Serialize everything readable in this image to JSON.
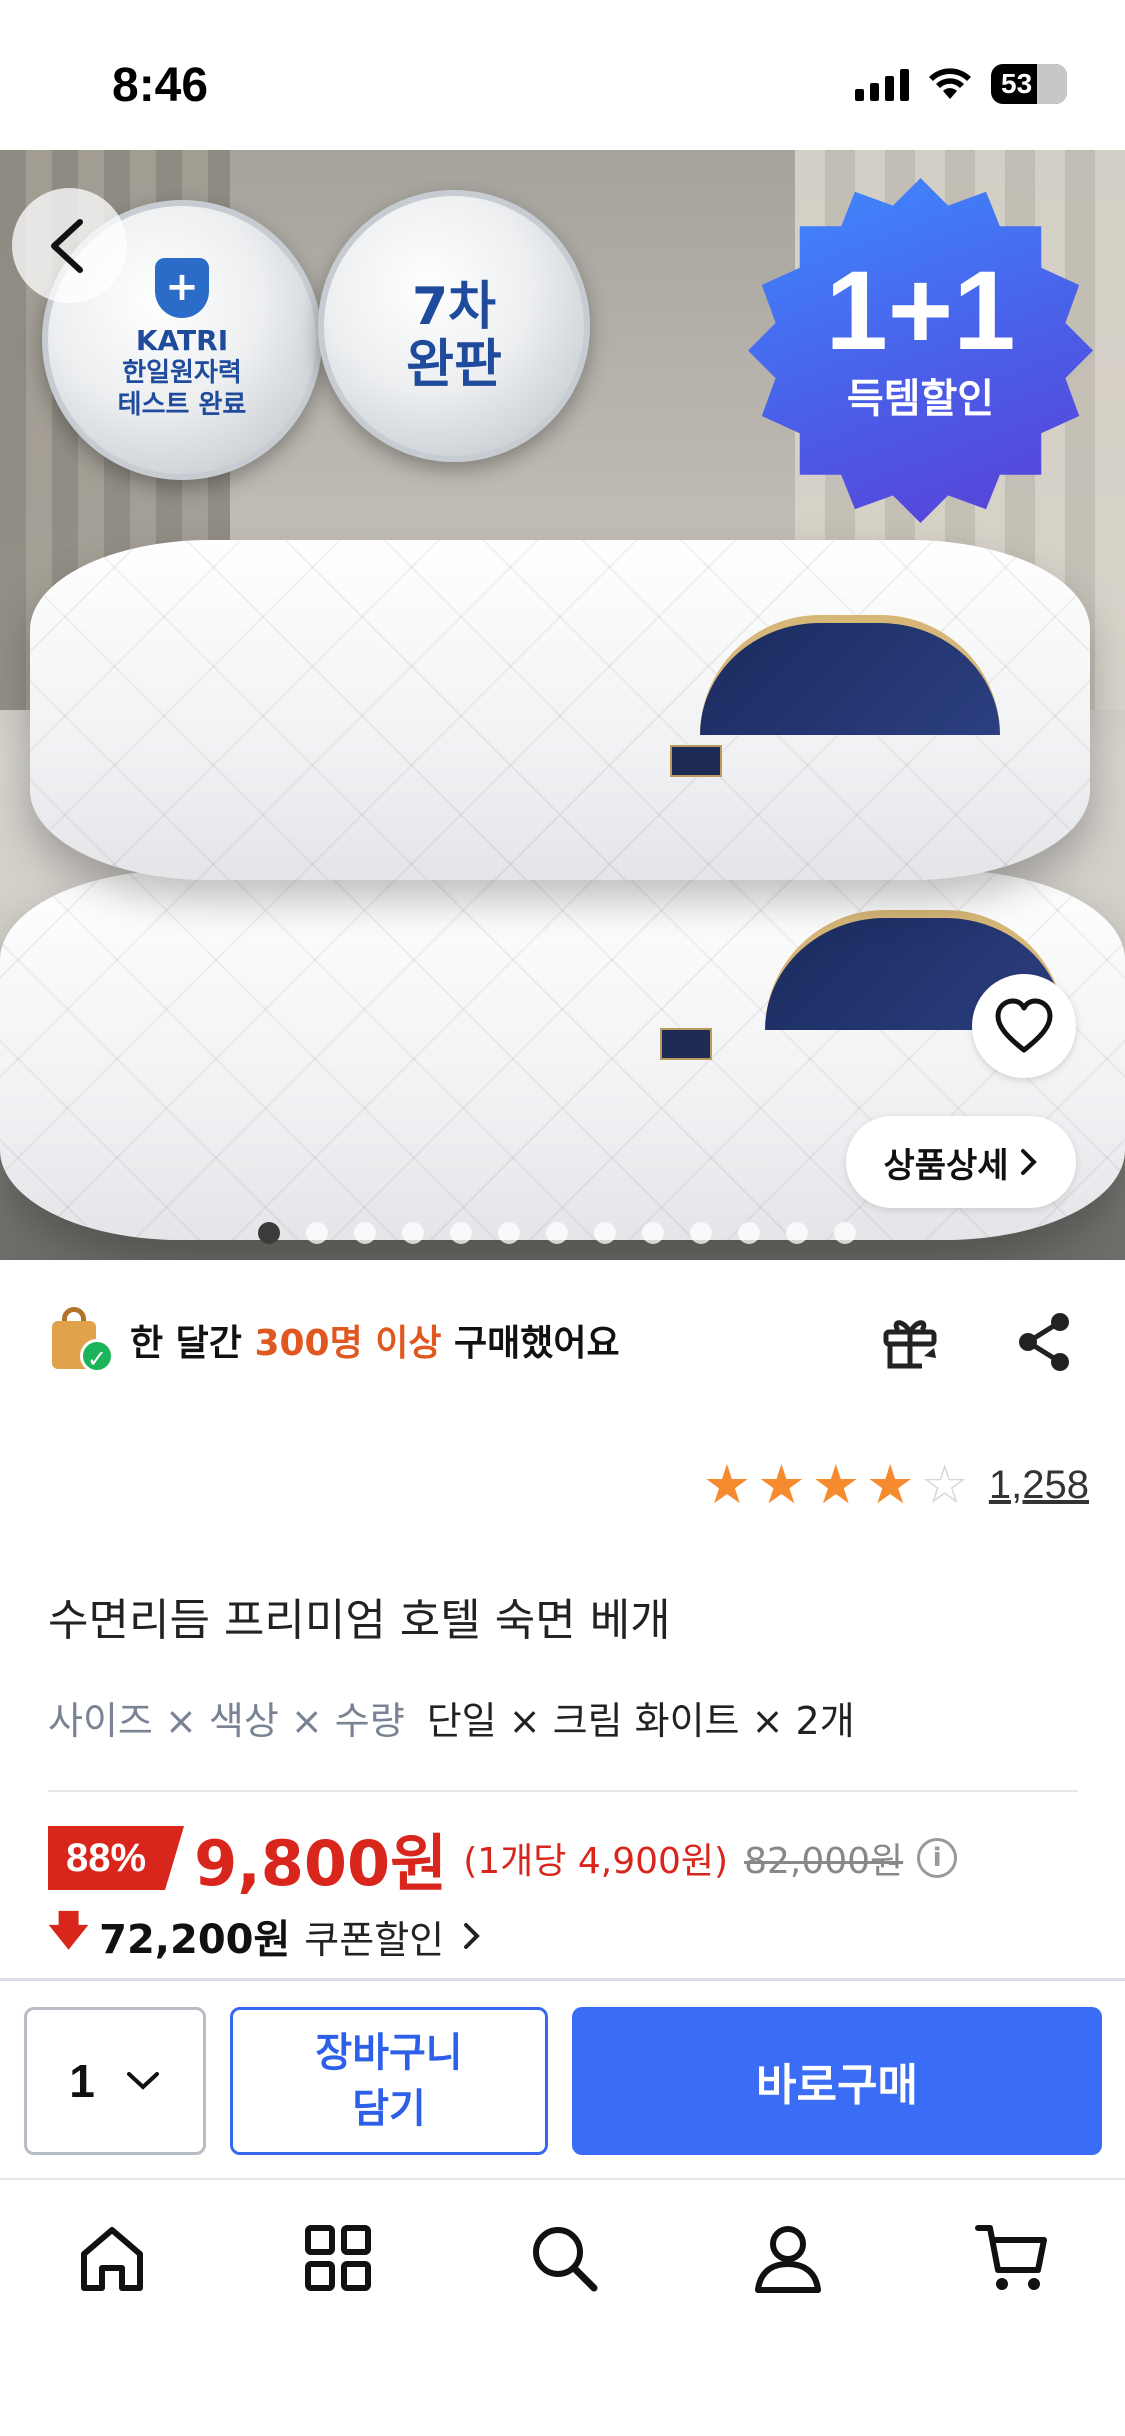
{
  "status_bar": {
    "time": "8:46",
    "battery": "53"
  },
  "hero": {
    "badge_katri_brand": "KATRI",
    "badge_katri_line1": "한일원자력",
    "badge_katri_line2": "테스트 완료",
    "badge_seventh_line1": "7차",
    "badge_seventh_line2": "완판",
    "promo_big": "1+1",
    "promo_small": "득템할인",
    "detail_button": "상품상세",
    "image_count": 13,
    "active_image_index": 0
  },
  "buyers": {
    "prefix": "한 달간 ",
    "highlight": "300명 이상",
    "suffix": " 구매했어요"
  },
  "rating": {
    "stars": 4,
    "max": 5,
    "count": "1,258"
  },
  "product": {
    "title": "수면리듬 프리미엄 호텔 숙면 베개",
    "options_label": "사이즈 × 색상 × 수량",
    "options_value": "단일 × 크림 화이트 × 2개"
  },
  "price": {
    "discount": "88%",
    "sale_price": "9,800원",
    "unit_price": "(1개당 4,900원)",
    "original_price": "82,000원",
    "coupon_amount": "72,200원",
    "coupon_label": "쿠폰할인"
  },
  "actions": {
    "quantity": "1",
    "cart_line1": "장바구니",
    "cart_line2": "담기",
    "buy_now": "바로구매"
  },
  "colors": {
    "accent_blue": "#3a6cf6",
    "price_red": "#d9261c",
    "highlight_orange": "#e0581f",
    "star_orange": "#f58b2e"
  },
  "tab_bar": [
    "home-icon",
    "categories-icon",
    "search-icon",
    "profile-icon",
    "cart-icon"
  ]
}
